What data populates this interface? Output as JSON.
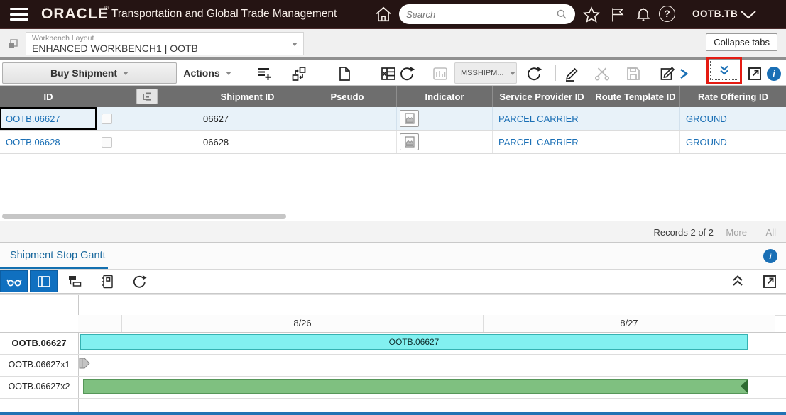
{
  "header": {
    "brand": "ORACLE",
    "brand_mark": "®",
    "app_title": "Transportation and Global Trade Management",
    "search_placeholder": "Search",
    "user_label": "OOTB.TB"
  },
  "glyphs": {
    "help": "?",
    "info": "i"
  },
  "workbench_bar": {
    "field_label": "Workbench Layout",
    "field_value": "ENHANCED WORKBENCH1 | OOTB",
    "collapse_tabs_label": "Collapse tabs"
  },
  "toolbar": {
    "view_button_label": "Buy Shipment",
    "actions_button_label": "Actions",
    "saved_query_label": "MSSHIPM...",
    "icons": [
      "add-to-list",
      "reassign",
      "document",
      "export-table",
      "refresh",
      "chart-disabled",
      "refresh",
      "edit-pencil",
      "unassign-disabled",
      "save-disabled",
      "edit-in-window",
      "expand-right-chevron",
      "show-more-double-chevron (red highlighted)",
      "open-in-new-window",
      "info"
    ]
  },
  "shipments_table": {
    "columns": [
      "ID",
      "",
      "Shipment ID",
      "Pseudo",
      "Indicator",
      "Service Provider ID",
      "Route Template ID",
      "Rate Offering ID"
    ],
    "rows": [
      {
        "id": "OOTB.06627",
        "shipment_id": "06627",
        "pseudo": "",
        "indicator": "document-indicator-icon",
        "service_provider_id": "PARCEL CARRIER",
        "route_template_id": "",
        "rate_offering_id": "GROUND",
        "highlighted": true
      },
      {
        "id": "OOTB.06628",
        "shipment_id": "06628",
        "pseudo": "",
        "indicator": "document-indicator-icon",
        "service_provider_id": "PARCEL CARRIER",
        "route_template_id": "",
        "rate_offering_id": "GROUND",
        "highlighted": false
      }
    ],
    "records_label": "Records 2 of 2",
    "more_label": "More",
    "all_label": "All"
  },
  "gantt_panel": {
    "tab_label": "Shipment Stop Gantt",
    "toolbar_icons": [
      "legend-glasses (active)",
      "panel-layout (active)",
      "gantt-hierarchy",
      "notebook",
      "refresh",
      "collapse-double-chevron-up",
      "open-in-new-window"
    ],
    "timeline": {
      "dates": [
        "8/26",
        "8/27"
      ]
    },
    "rows": [
      {
        "label": "OOTB.06627",
        "bar_label": "OOTB.06627",
        "bar_kind": "shipment-duration",
        "bar_color": "#82f0f0",
        "start_frac": 0.0,
        "end_frac": 0.96
      },
      {
        "label": "OOTB.06627x1",
        "bar_label": "",
        "bar_kind": "stop-marker",
        "bar_color": "#bdbdbd",
        "start_frac": 0.0,
        "end_frac": 0.015
      },
      {
        "label": "OOTB.06627x2",
        "bar_label": "",
        "bar_kind": "transit-activity",
        "bar_color": "#7fc080",
        "start_frac": 0.004,
        "end_frac": 0.96
      }
    ]
  },
  "colors": {
    "topbar_bg": "#251413",
    "accent_blue": "#1a6fb5",
    "table_header_bg": "#6e6e6e",
    "row_highlight": "#e8f2f9",
    "active_button_blue": "#1070c0",
    "highlight_red": "#e51b12",
    "cyan_bar": "#82f0f0",
    "green_bar": "#7fc080"
  }
}
